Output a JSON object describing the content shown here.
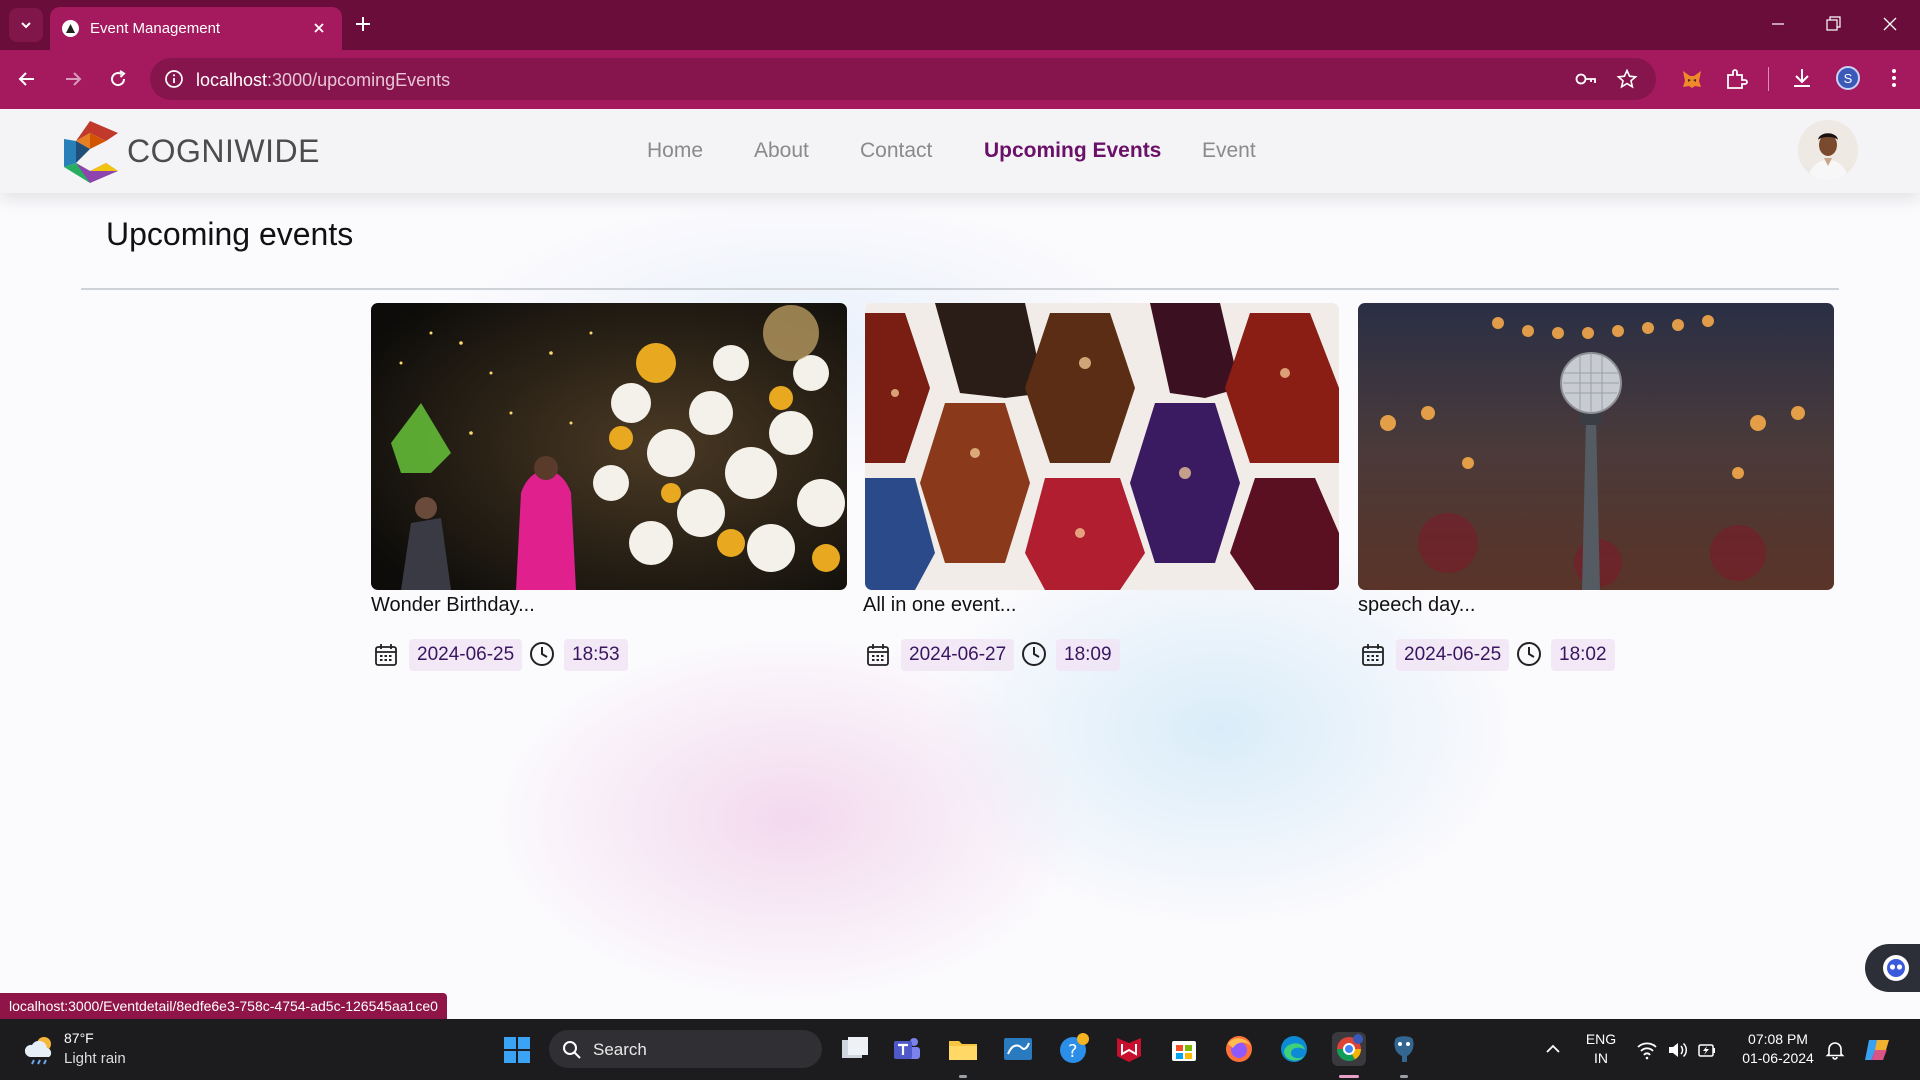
{
  "browser": {
    "tab_title": "Event Management",
    "url_host": "localhost",
    "url_path": ":3000/upcomingEvents",
    "profile_initial": "S"
  },
  "app": {
    "logo_text": "COGNIWIDE",
    "nav": [
      {
        "label": "Home"
      },
      {
        "label": "About"
      },
      {
        "label": "Contact"
      },
      {
        "label": "Upcoming Events",
        "active": true
      },
      {
        "label": "Event"
      }
    ],
    "page_title": "Upcoming events",
    "events": [
      {
        "title": "Wonder Birthday...",
        "date": "2024-06-25",
        "time": "18:53",
        "image": "balloon-party-photo"
      },
      {
        "title": "All in one event...",
        "date": "2024-06-27",
        "time": "18:09",
        "image": "event-collage-photo"
      },
      {
        "title": "speech day...",
        "date": "2024-06-25",
        "time": "18:02",
        "image": "microphone-stage-photo"
      }
    ]
  },
  "status_bar_url": "localhost:3000/Eventdetail/8edfe6e3-758c-4754-ad5c-126545aa1ce0",
  "taskbar": {
    "weather_temp": "87°F",
    "weather_desc": "Light rain",
    "search_placeholder": "Search",
    "lang_line1": "ENG",
    "lang_line2": "IN",
    "time": "07:08 PM",
    "date": "01-06-2024"
  },
  "colors": {
    "browser_tabbar": "#6a0d3a",
    "browser_toolbar": "#a51a5e",
    "nav_active": "#6b1068",
    "taskbar": "#1c1c1e"
  }
}
